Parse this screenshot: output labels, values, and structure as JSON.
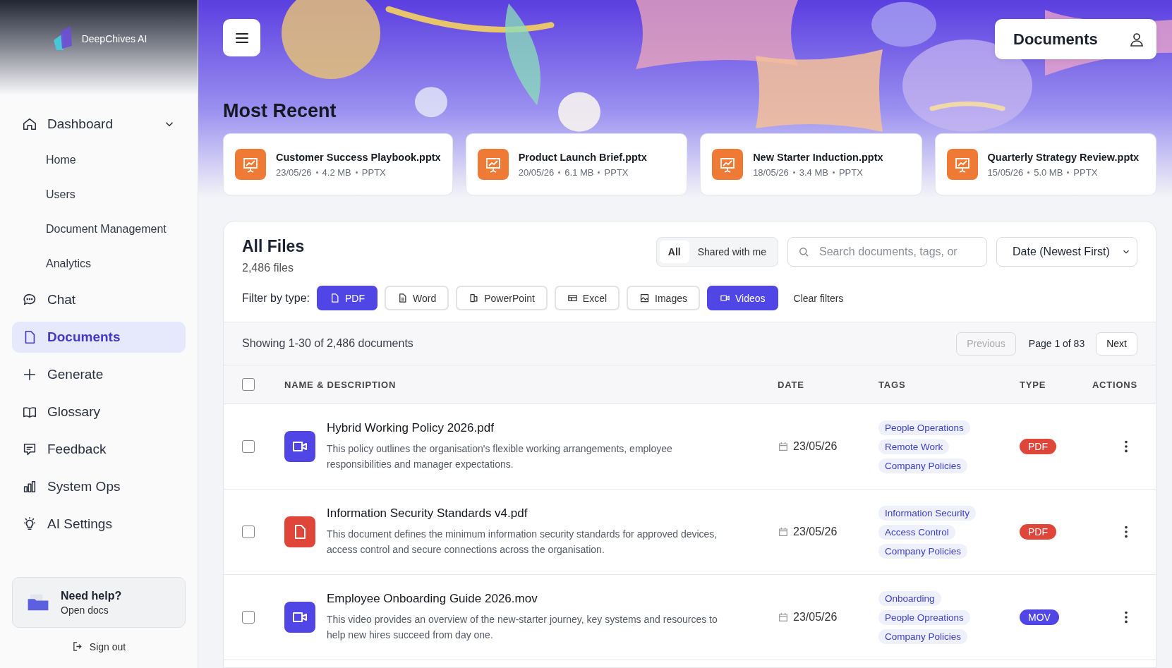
{
  "brand": {
    "name": "DeepChives AI"
  },
  "nav": [
    {
      "label": "Dashboard",
      "kind": "home",
      "selected": false,
      "expanded": true,
      "children": [
        {
          "label": "Home",
          "selected": false
        },
        {
          "label": "Users",
          "selected": false
        },
        {
          "label": "Document Management",
          "selected": false
        },
        {
          "label": "Analytics",
          "selected": false
        }
      ]
    },
    {
      "label": "Chat",
      "kind": "chat",
      "selected": false
    },
    {
      "label": "Documents",
      "kind": "doc",
      "selected": true
    },
    {
      "label": "Generate",
      "kind": "plus",
      "selected": false
    },
    {
      "label": "Glossary",
      "kind": "book",
      "selected": false
    },
    {
      "label": "Feedback",
      "kind": "feedback",
      "selected": false
    },
    {
      "label": "System Ops",
      "kind": "bars",
      "selected": false
    },
    {
      "label": "AI Settings",
      "kind": "bulb",
      "selected": false
    }
  ],
  "help": {
    "title": "Need help?",
    "subtitle": "Open docs"
  },
  "sign_out": "Sign out",
  "header": {
    "title": "Documents"
  },
  "recent": {
    "title": "Most Recent",
    "items": [
      {
        "name": "Customer Success Playbook.pptx",
        "date": "23/05/26",
        "size": "4.2 MB",
        "type": "PPTX"
      },
      {
        "name": "Product Launch Brief.pptx",
        "date": "20/05/26",
        "size": "6.1 MB",
        "type": "PPTX"
      },
      {
        "name": "New Starter Induction.pptx",
        "date": "18/05/26",
        "size": "3.4 MB",
        "type": "PPTX"
      },
      {
        "name": "Quarterly Strategy Review.pptx",
        "date": "15/05/26",
        "size": "5.0 MB",
        "type": "PPTX"
      }
    ]
  },
  "files": {
    "title": "All Files",
    "count": "2,486 files",
    "scope": [
      {
        "label": "All",
        "selected": true
      },
      {
        "label": "Shared with me",
        "selected": false
      }
    ],
    "search": {
      "placeholder": "Search documents, tags, or"
    },
    "sort": {
      "value": "Date (Newest First)"
    },
    "filter_label": "Filter by type:",
    "filters": [
      {
        "label": "PDF",
        "kind": "doc",
        "selected": true
      },
      {
        "label": "Word",
        "kind": "lines",
        "selected": false
      },
      {
        "label": "PowerPoint",
        "kind": "ppt",
        "selected": false
      },
      {
        "label": "Excel",
        "kind": "table",
        "selected": false
      },
      {
        "label": "Images",
        "kind": "image",
        "selected": false
      },
      {
        "label": "Videos",
        "kind": "video",
        "selected": true
      }
    ],
    "clear": "Clear filters",
    "showing": "Showing 1-30 of 2,486 documents",
    "pager": {
      "previous": "Previous",
      "previous_disabled": true,
      "page": "Page 1 of 83",
      "next": "Next"
    },
    "select_all": {
      "checked": false
    },
    "columns": [
      "NAME & DESCRIPTION",
      "DATE",
      "TAGS",
      "TYPE",
      "ACTIONS"
    ],
    "rows": [
      {
        "kind": "video",
        "checked": false,
        "name": "Hybrid Working Policy 2026.pdf",
        "description": "This policy outlines the organisation's flexible working arrangements, employee responsibilities and manager expectations.",
        "date": "23/05/26",
        "tags": [
          "People Operations",
          "Remote Work",
          "Company Policies"
        ],
        "type": "PDF",
        "color": "#e0453a"
      },
      {
        "kind": "document",
        "checked": false,
        "name": "Information Security Standards v4.pdf",
        "description": "This document defines the minimum information security standards for approved devices, access control and secure connections across the organisation.",
        "date": "23/05/26",
        "tags": [
          "Information Security",
          "Access Control",
          "Company Policies"
        ],
        "type": "PDF",
        "color": "#e0453a"
      },
      {
        "kind": "video",
        "checked": false,
        "name": "Employee Onboarding Guide 2026.mov",
        "description": "This video provides an overview of the new-starter journey, key systems and resources to help new hires succeed from day one.",
        "date": "23/05/26",
        "tags": [
          "Onboarding",
          "People Opreations",
          "Company Policies"
        ],
        "type": "MOV",
        "color": "#4f46e5"
      }
    ]
  }
}
